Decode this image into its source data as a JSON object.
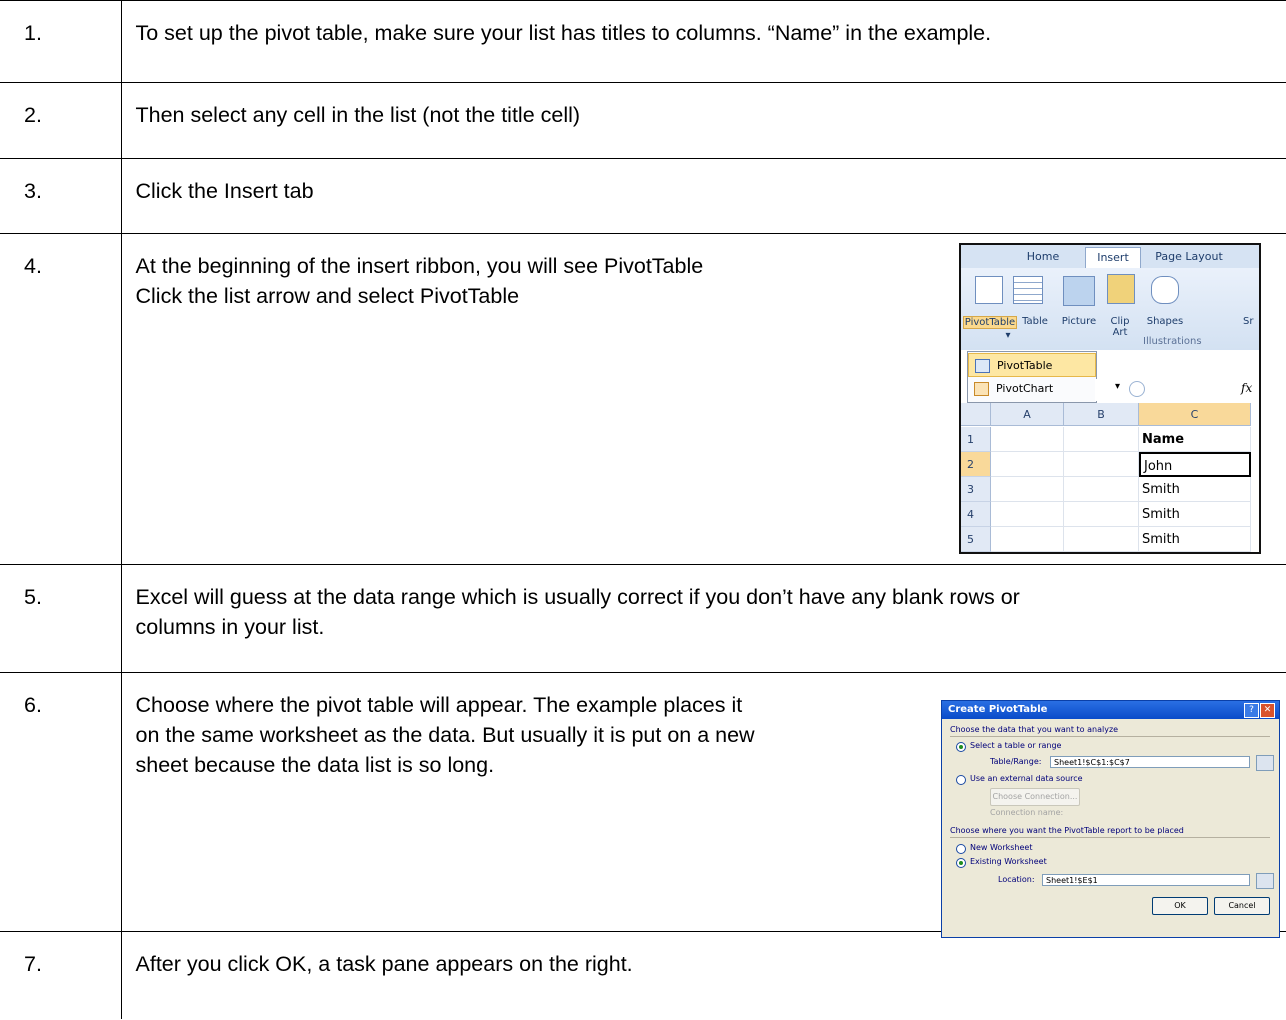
{
  "steps": [
    {
      "num": "1.",
      "lines": [
        "To set up the pivot table, make sure your list has titles to columns. “Name” in the example."
      ]
    },
    {
      "num": "2.",
      "lines": [
        "Then select any cell in the list (not the title cell)"
      ]
    },
    {
      "num": "3.",
      "lines": [
        "Click the Insert tab"
      ]
    },
    {
      "num": "4.",
      "lines": [
        "At the beginning of the insert ribbon, you will see PivotTable",
        "Click the list arrow and select PivotTable"
      ]
    },
    {
      "num": "5.",
      "lines": [
        "Excel will guess at the data range which is usually correct if you don’t have any blank rows or",
        "columns in your list."
      ]
    },
    {
      "num": "6.",
      "lines": [
        "Choose where the pivot table will appear. The example places it",
        "on the same worksheet as the data. But usually it is put on a new",
        "sheet because the data list is so long."
      ]
    },
    {
      "num": "7.",
      "lines": [
        "After you click OK, a task pane appears on the right."
      ]
    }
  ],
  "excel_screenshot": {
    "tabs": [
      "Home",
      "Insert",
      "Page Layout"
    ],
    "ribbon_buttons": [
      "PivotTable",
      "Table",
      "Picture",
      "Clip Art",
      "Shapes",
      "Sr"
    ],
    "group_label": "Illustrations",
    "menu_items": [
      "PivotTable",
      "PivotChart"
    ],
    "formula_fx": "fx",
    "columns": [
      "A",
      "B",
      "C"
    ],
    "rows": [
      "1",
      "2",
      "3",
      "4",
      "5"
    ],
    "cells_col_c": [
      "Name",
      "John",
      "Smith",
      "Smith",
      "Smith"
    ]
  },
  "dialog_screenshot": {
    "title": "Create PivotTable",
    "choose_data": "Choose the data that you want to analyze",
    "select_table": "Select a table or range",
    "table_range_label": "Table/Range:",
    "table_range_value": "Sheet1!$C$1:$C$7",
    "external_source": "Use an external data source",
    "choose_connection": "Choose Connection...",
    "connection_name": "Connection name:",
    "choose_where": "Choose where you want the PivotTable report to be placed",
    "new_worksheet": "New Worksheet",
    "existing_worksheet": "Existing Worksheet",
    "location_label": "Location:",
    "location_value": "Sheet1!$E$1",
    "ok": "OK",
    "cancel": "Cancel"
  },
  "colors": {
    "border": "#000000",
    "ribbon": "#d6e3f3",
    "dialog_title": "#0a4bc9"
  }
}
